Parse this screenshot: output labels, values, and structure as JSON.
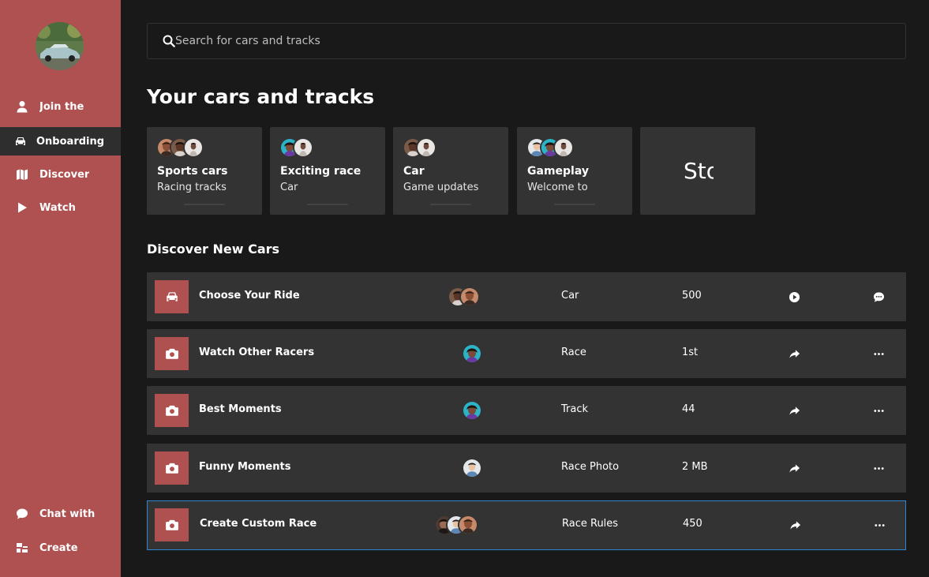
{
  "search": {
    "placeholder": "Search for cars and tracks"
  },
  "page_title": "Your cars and tracks",
  "sidebar": {
    "items": [
      {
        "label": "Join the",
        "icon": "user-icon"
      },
      {
        "label": "Onboarding",
        "icon": "car-icon",
        "active": true
      },
      {
        "label": "Discover",
        "icon": "map-icon"
      },
      {
        "label": "Watch",
        "icon": "play-icon"
      }
    ],
    "bottom_items": [
      {
        "label": "Chat with",
        "icon": "chat-bubble-icon"
      },
      {
        "label": "Create",
        "icon": "create-icon"
      }
    ]
  },
  "cards": [
    {
      "title": "Sports cars",
      "subtitle": "Racing tracks"
    },
    {
      "title": "Exciting race",
      "subtitle": "Car"
    },
    {
      "title": "Car",
      "subtitle": "Game updates"
    },
    {
      "title": "Gameplay",
      "subtitle": "Welcome to"
    },
    {
      "title": "Sto"
    }
  ],
  "section_title": "Discover New Cars",
  "rows": [
    {
      "name": "Choose Your Ride",
      "type": "Car",
      "value": "500",
      "thumb_icon": "car-icon",
      "action1": "play-circle-icon",
      "action2": "chat-bubble-icon"
    },
    {
      "name": "Watch Other Racers",
      "type": "Race",
      "value": "1st",
      "thumb_icon": "camera-icon",
      "action1": "share-icon",
      "action2": "more-icon"
    },
    {
      "name": "Best Moments",
      "type": "Track",
      "value": "44",
      "thumb_icon": "camera-icon",
      "action1": "share-icon",
      "action2": "more-icon"
    },
    {
      "name": "Funny Moments",
      "type": "Race Photo",
      "value": "2 MB",
      "thumb_icon": "camera-icon",
      "action1": "share-icon",
      "action2": "more-icon"
    },
    {
      "name": "Create Custom Race",
      "type": "Race Rules",
      "value": "450",
      "thumb_icon": "camera-icon",
      "action1": "share-icon",
      "action2": "more-icon",
      "selected": true
    }
  ],
  "colors": {
    "sidebar": "#b05151",
    "background": "#191919",
    "panel": "#333333",
    "active_nav": "#2e2e2e",
    "selection_border": "#2f86d6"
  }
}
